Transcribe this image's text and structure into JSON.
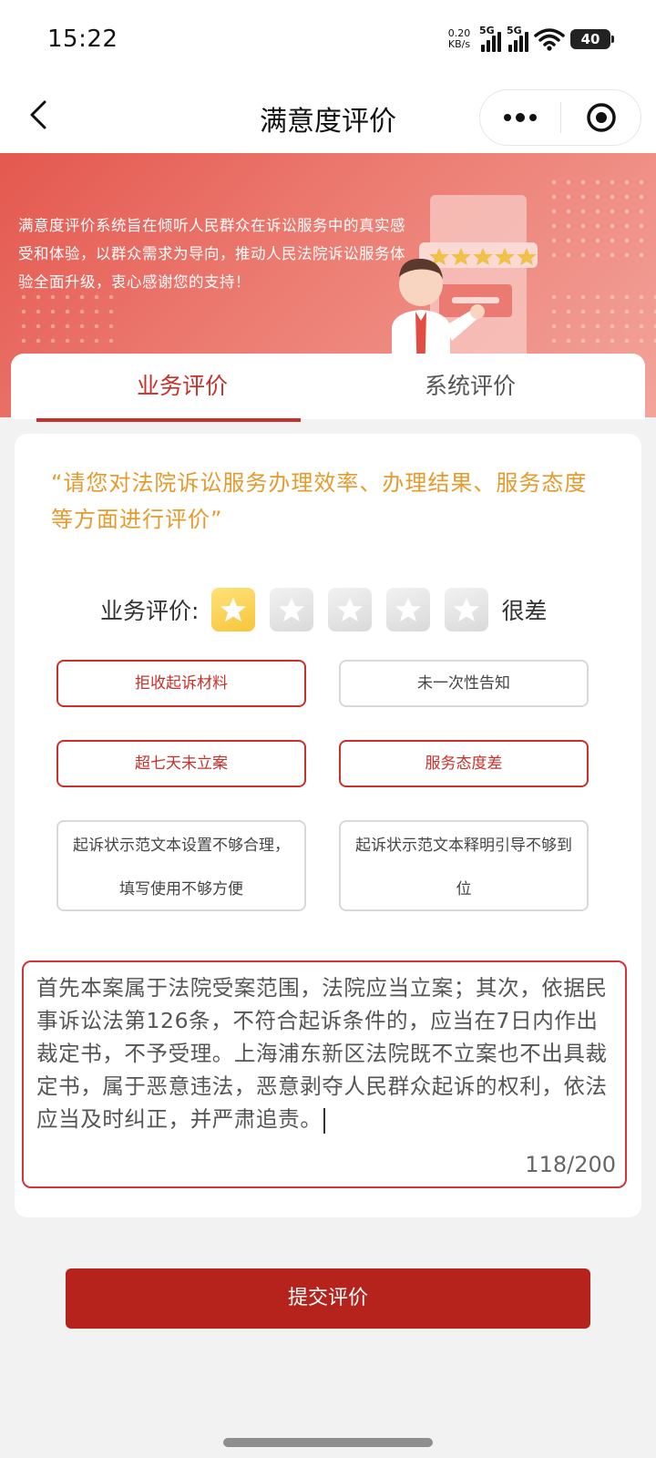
{
  "status_bar": {
    "time": "15:22",
    "net_speed_value": "0.20",
    "net_speed_unit": "KB/s",
    "signal1_label": "5G",
    "signal2_label": "5G",
    "battery": "40"
  },
  "nav": {
    "title": "满意度评价"
  },
  "banner": {
    "intro": "满意度评价系统旨在倾听人民群众在诉讼服务中的真实感受和体验，以群众需求为导向，推动人民法院诉讼服务体验全面升级，衷心感谢您的支持！"
  },
  "tabs": [
    {
      "label": "业务评价",
      "active": true
    },
    {
      "label": "系统评价",
      "active": false
    }
  ],
  "evaluation": {
    "prompt": "“请您对法院诉讼服务办理效率、办理结果、服务态度等方面进行评价”",
    "rating_label": "业务评价:",
    "rating_value": 1,
    "rating_max": 5,
    "rating_text": "很差",
    "tags": [
      {
        "label": "拒收起诉材料",
        "selected": true
      },
      {
        "label": "未一次性告知",
        "selected": false
      },
      {
        "label": "超七天未立案",
        "selected": true
      },
      {
        "label": "服务态度差",
        "selected": true
      },
      {
        "label": "起诉状示范文本设置不够合理，填写使用不够方便",
        "selected": false
      },
      {
        "label": "起诉状示范文本释明引导不够到位",
        "selected": false
      }
    ],
    "comment": "首先本案属于法院受案范围，法院应当立案；其次，依据民事诉讼法第126条，不符合起诉条件的，应当在7日内作出裁定书，不予受理。上海浦东新区法院既不立案也不出具裁定书，属于恶意违法，恶意剥夺人民群众起诉的权利，依法应当及时纠正，并严肃追责。",
    "counter": "118/200"
  },
  "submit_label": "提交评价",
  "colors": {
    "brand_red": "#c8302a",
    "submit_red": "#b5231c",
    "prompt_orange": "#e79a2c",
    "star_gold": "#f6c53b"
  }
}
